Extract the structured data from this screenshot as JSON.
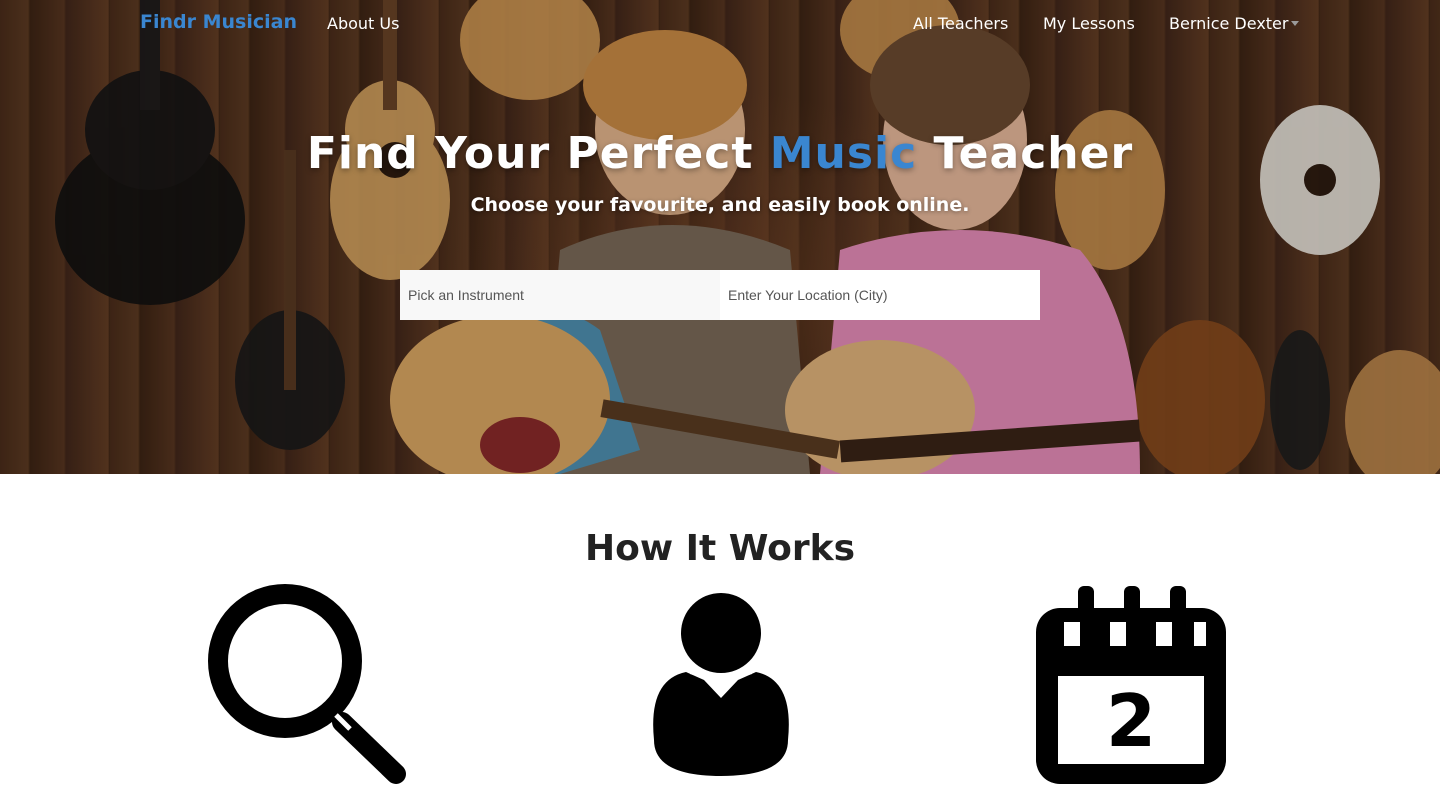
{
  "navbar": {
    "brand": "Findr Musician",
    "links": [
      {
        "label": "About Us"
      },
      {
        "label": "All Teachers"
      },
      {
        "label": "My Lessons"
      }
    ],
    "user": {
      "name": "Bernice Dexter"
    }
  },
  "hero": {
    "title_before": "Find Your Perfect ",
    "title_accent": "Music",
    "title_after": " Teacher",
    "subtitle": "Choose your favourite, and easily book online.",
    "search": {
      "instrument_placeholder": "Pick an Instrument",
      "location_placeholder": "Enter Your Location (City)"
    }
  },
  "how_it_works": {
    "title": "How It Works",
    "steps": [
      {
        "icon": "magnifying-glass-icon"
      },
      {
        "icon": "user-icon"
      },
      {
        "icon": "calendar-icon",
        "day": "2"
      }
    ]
  },
  "colors": {
    "accent": "#3a86d0",
    "text_dark": "#222222",
    "white": "#ffffff"
  }
}
